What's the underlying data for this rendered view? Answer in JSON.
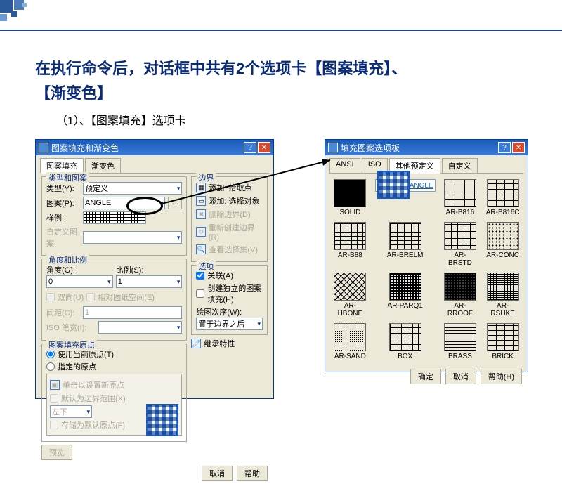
{
  "heading_line1": "在执行命令后，对话框中共有2个选项卡【图案填充】、",
  "heading_line2": "【渐变色】",
  "subheading": "（1）、【图案填充】选项卡",
  "dialog1": {
    "title": "图案填充和渐变色",
    "tabs": [
      "图案填充",
      "渐变色"
    ],
    "group_type": "类型和图案",
    "label_type": "类型(Y):",
    "value_type": "预定义",
    "label_pattern": "图案(P):",
    "value_pattern": "ANGLE",
    "label_sample": "样例:",
    "label_custom": "自定义图案:",
    "group_angle": "角度和比例",
    "label_angle": "角度(G):",
    "value_angle": "0",
    "label_scale": "比例(S):",
    "value_scale": "1",
    "chk_double": "双向(U)",
    "chk_relpaper": "相对图纸空间(E)",
    "label_spacing": "间距(C):",
    "label_isopen": "ISO 笔宽(I):",
    "group_origin": "图案填充原点",
    "radio_current": "使用当前原点(T)",
    "radio_specified": "指定的原点",
    "btn_click_origin": "单击以设置新原点",
    "chk_default_bound": "默认为边界范围(X)",
    "sel_lowerleft": "左下",
    "chk_store": "存储为默认原点(F)",
    "btn_preview": "预览",
    "group_boundary": "边界",
    "pick_add_points": "添加: 拾取点",
    "pick_add_select": "添加: 选择对象",
    "pick_delete": "删除边界(D)",
    "pick_recreate": "重新创建边界(R)",
    "pick_view": "查看选择集(V)",
    "group_options": "选项",
    "chk_assoc": "关联(A)",
    "chk_separate": "创建独立的图案填充(H)",
    "label_draworder": "绘图次序(W):",
    "value_draworder": "置于边界之后",
    "chk_inherit": "继承特性",
    "btn_cancel": "取消",
    "btn_help": "帮助"
  },
  "dialog2": {
    "title": "填充图案选项板",
    "tabs": [
      "ANSI",
      "ISO",
      "其他预定义",
      "自定义"
    ],
    "patterns": [
      "SOLID",
      "ANGLE",
      "AR-B816",
      "AR-B816C",
      "AR-B88",
      "AR-BRELM",
      "AR-BRSTD",
      "AR-CONC",
      "AR-HBONE",
      "AR-PARQ1",
      "AR-RROOF",
      "AR-RSHKE",
      "AR-SAND",
      "BOX",
      "BRASS",
      "BRICK"
    ],
    "btn_ok": "确定",
    "btn_cancel": "取消",
    "btn_help": "帮助(H)"
  }
}
